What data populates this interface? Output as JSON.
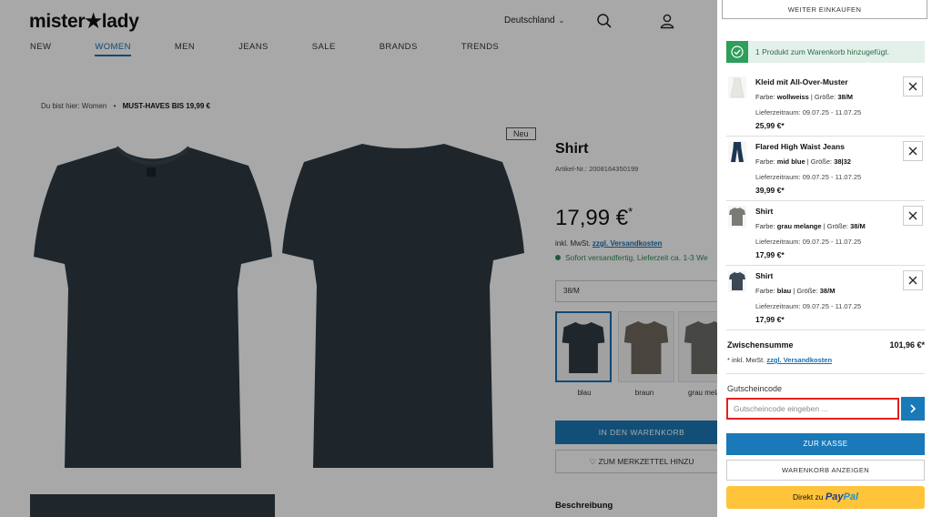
{
  "header": {
    "logo": "mister★lady",
    "country": "Deutschland",
    "icons": [
      "search-icon",
      "user-icon"
    ]
  },
  "nav": {
    "items": [
      "NEW",
      "WOMEN",
      "MEN",
      "JEANS",
      "SALE",
      "BRANDS",
      "TRENDS"
    ],
    "active": "WOMEN"
  },
  "breadcrumb": {
    "prefix": "Du bist hier:",
    "level1": "Women",
    "separator": "•",
    "current": "MUST-HAVES BIS 19,99 €"
  },
  "product": {
    "badge": "Neu",
    "title": "Shirt",
    "article_nr": "Artikel-Nr.: 2008164350199",
    "price": "17,99 €",
    "price_star": "*",
    "vat_text": "inkl. MwSt.",
    "shipping_link": "zzgl. Versandkosten",
    "stock": "Sofort versandfertig, Lieferzeit ca. 1-3 We",
    "size": "38/M",
    "variants": [
      {
        "label": "blau",
        "color": "#2f3b44"
      },
      {
        "label": "braun",
        "color": "#6f6a5f"
      },
      {
        "label": "grau melan",
        "color": "#6d6d68"
      }
    ],
    "cart_button": "IN DEN WARENKORB",
    "wishlist_button": "ZUM MERKZETTEL HINZU",
    "description_heading": "Beschreibung",
    "shirt_color": "#2e3a43"
  },
  "cart": {
    "continue_button": "WEITER EINKAUFEN",
    "notice": "1 Produkt zum Warenkorb hinzugefügt.",
    "color_label": "Farbe:",
    "size_label": "Größe:",
    "delivery_label": "Lieferzeitraum:",
    "items": [
      {
        "name": "Kleid mit All-Over-Muster",
        "color": "wollweiss",
        "size": "38/M",
        "delivery": "09.07.25 - 11.07.25",
        "price": "25,99 €*",
        "thumb": "dress"
      },
      {
        "name": "Flared High Waist Jeans",
        "color": "mid blue",
        "size": "38|32",
        "delivery": "09.07.25 - 11.07.25",
        "price": "39,99 €*",
        "thumb": "jeans"
      },
      {
        "name": "Shirt",
        "color": "grau melange",
        "size": "38/M",
        "delivery": "09.07.25 - 11.07.25",
        "price": "17,99 €*",
        "thumb": "shirt-grey"
      },
      {
        "name": "Shirt",
        "color": "blau",
        "size": "38/M",
        "delivery": "09.07.25 - 11.07.25",
        "price": "17,99 €*",
        "thumb": "shirt-blue"
      }
    ],
    "subtotal_label": "Zwischensumme",
    "subtotal_value": "101,96 €*",
    "vat_text": "* inkl. MwSt.",
    "shipping_link": "zzgl. Versandkosten",
    "coupon_label": "Gutscheincode",
    "coupon_placeholder": "Gutscheincode eingeben ...",
    "checkout_button": "ZUR KASSE",
    "view_cart_button": "WARENKORB ANZEIGEN",
    "paypal_prefix": "Direkt zu",
    "paypal_brand_1": "Pay",
    "paypal_brand_2": "Pal"
  },
  "colors": {
    "accent": "#1a79b8",
    "success": "#2e9e5b",
    "error_outline": "#e02020",
    "paypal_yellow": "#ffc43a"
  }
}
